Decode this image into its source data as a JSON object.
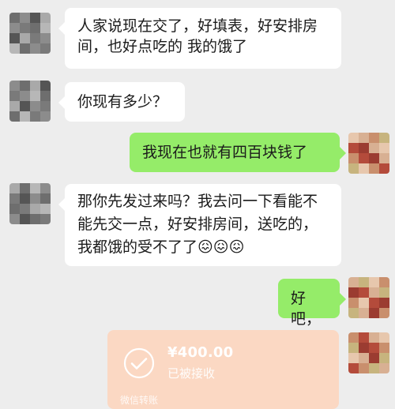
{
  "messages": [
    {
      "text": "人家说现在交了，好填表，好安排房间，也好点吃的 我的饿了"
    },
    {
      "text": "你现有多少？"
    },
    {
      "text": "我现在也就有四百块钱了"
    },
    {
      "text": "那你先发过来吗？我去问一下看能不能先交一点，好安排房间，送吃的，我都饿的受不了了😖😖😖"
    },
    {
      "text": "好吧，"
    }
  ],
  "transfer": {
    "amount": "¥400.00",
    "status": "已被接收",
    "footer": "微信转账"
  }
}
